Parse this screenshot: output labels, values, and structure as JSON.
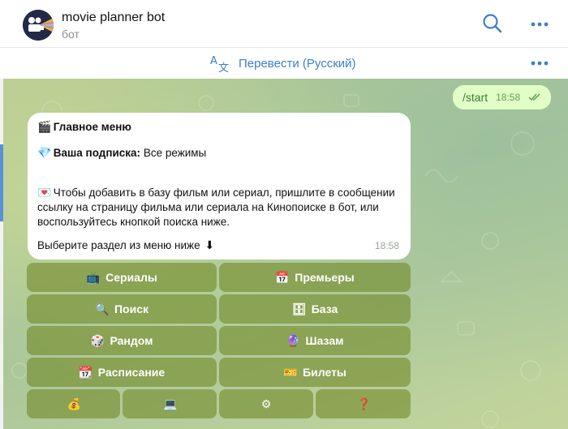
{
  "header": {
    "title": "movie planner bot",
    "subtitle": "бот",
    "search_icon": "search-icon",
    "menu_icon": "more-dots-icon"
  },
  "translate_bar": {
    "label": "Перевести (Русский)",
    "icon": "translate-icon",
    "menu_icon": "more-dots-icon"
  },
  "messages": {
    "outgoing": {
      "text": "/start",
      "time": "18:58",
      "status": "read-double-check"
    },
    "incoming": {
      "title": "Главное меню",
      "subscription_label": "Ваша подписка:",
      "subscription_value": "Все режимы",
      "body_lines": [
        "Чтобы добавить в базу фильм или сериал, пришлите в сообщении",
        "ссылку на страницу фильма или сериала на Кинопоиске в бот, или",
        "воспользуйтесь кнопкой поиска ниже."
      ],
      "footer": "Выберите раздел из меню ниже",
      "time": "18:58"
    }
  },
  "keyboard": {
    "rows": [
      [
        {
          "label": "Сериалы",
          "icon": "tv-icon"
        },
        {
          "label": "Премьеры",
          "icon": "calendar-icon"
        }
      ],
      [
        {
          "label": "Поиск",
          "icon": "magnifier-icon"
        },
        {
          "label": "База",
          "icon": "cabinet-icon"
        }
      ],
      [
        {
          "label": "Рандом",
          "icon": "dice-icon"
        },
        {
          "label": "Шазам",
          "icon": "crystal-ball-icon"
        }
      ],
      [
        {
          "label": "Расписание",
          "icon": "schedule-icon"
        },
        {
          "label": "Билеты",
          "icon": "ticket-icon"
        }
      ],
      [
        {
          "label": "",
          "icon": "money-bag-icon"
        },
        {
          "label": "",
          "icon": "computer-icon"
        },
        {
          "label": "",
          "icon": "gear-icon"
        },
        {
          "label": "",
          "icon": "question-icon"
        }
      ]
    ]
  },
  "colors": {
    "accent": "#3d7fc6",
    "keyboard_button": "#7a8f2f",
    "outgoing_bubble": "#e1fec6"
  }
}
